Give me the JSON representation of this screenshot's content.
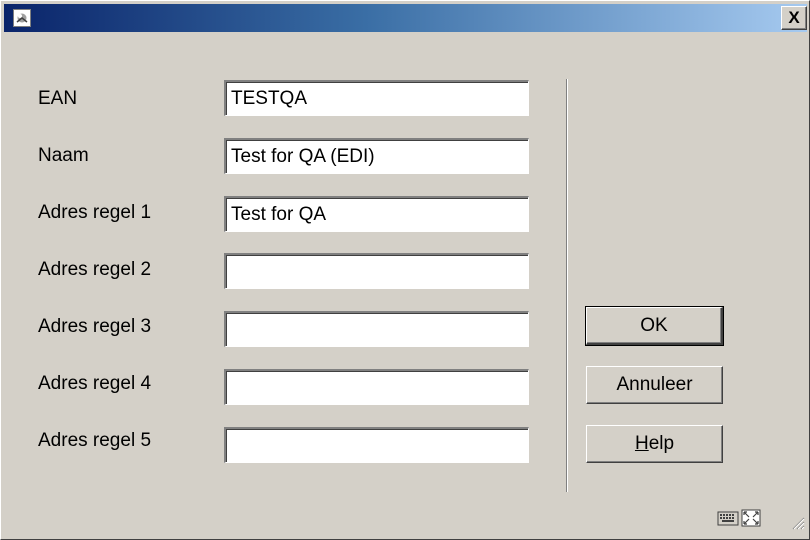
{
  "window": {
    "title": ""
  },
  "titlebar": {
    "close_label": "X"
  },
  "form": {
    "fields": [
      {
        "label": "EAN",
        "value": "TESTQA"
      },
      {
        "label": "Naam",
        "value": "Test for QA (EDI)"
      },
      {
        "label": "Adres regel 1",
        "value": "Test for QA"
      },
      {
        "label": "Adres regel 2",
        "value": ""
      },
      {
        "label": "Adres regel 3",
        "value": ""
      },
      {
        "label": "Adres regel 4",
        "value": ""
      },
      {
        "label": "Adres regel 5",
        "value": ""
      }
    ]
  },
  "buttons": {
    "ok": "OK",
    "cancel": "Annuleer",
    "help_prefix": "H",
    "help_rest": "elp"
  },
  "status": {
    "icons": [
      "keyboard-icon",
      "fullscreen-icon",
      "resize-grip-icon"
    ]
  }
}
